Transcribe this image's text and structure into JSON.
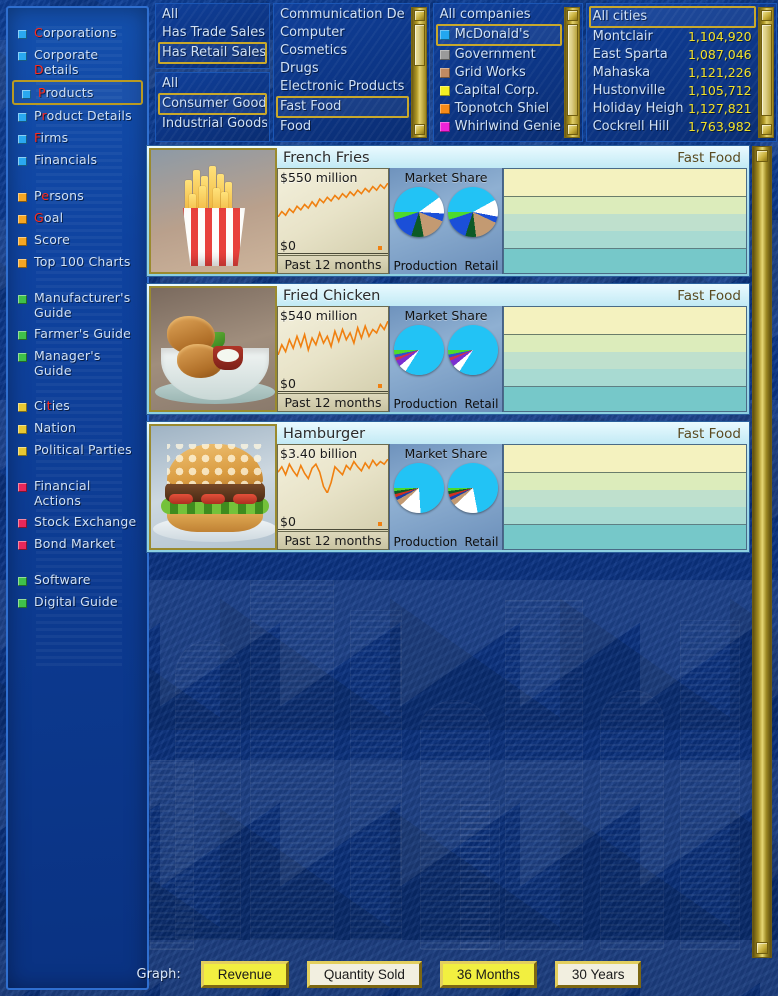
{
  "sidebar": {
    "items": [
      {
        "label": "Corporations",
        "hotkey": "C",
        "bullet": "#2aa8f0",
        "group": 0
      },
      {
        "label": "Corporate Details",
        "hotkey": "D",
        "bullet": "#2aa8f0",
        "group": 0
      },
      {
        "label": "Products",
        "hotkey": "P",
        "bullet": "#2aa8f0",
        "group": 0,
        "selected": true
      },
      {
        "label": "Product Details",
        "hotkey": "r",
        "bullet": "#2aa8f0",
        "group": 0
      },
      {
        "label": "Firms",
        "hotkey": "F",
        "bullet": "#2aa8f0",
        "group": 0
      },
      {
        "label": "Financials",
        "hotkey": "",
        "bullet": "#2aa8f0",
        "group": 0
      },
      {
        "label": "Persons",
        "hotkey": "e",
        "bullet": "#f5a623",
        "group": 1
      },
      {
        "label": "Goal",
        "hotkey": "G",
        "bullet": "#f5a623",
        "group": 1
      },
      {
        "label": "Score",
        "hotkey": "",
        "bullet": "#f5a623",
        "group": 1
      },
      {
        "label": "Top 100 Charts",
        "hotkey": "",
        "bullet": "#f5a623",
        "group": 1
      },
      {
        "label": "Manufacturer's Guide",
        "hotkey": "",
        "bullet": "#3fc14a",
        "group": 2
      },
      {
        "label": "Farmer's Guide",
        "hotkey": "",
        "bullet": "#3fc14a",
        "group": 2
      },
      {
        "label": "Manager's Guide",
        "hotkey": "",
        "bullet": "#3fc14a",
        "group": 2
      },
      {
        "label": "Cities",
        "hotkey": "t",
        "bullet": "#e8c832",
        "group": 3
      },
      {
        "label": "Nation",
        "hotkey": "",
        "bullet": "#e8c832",
        "group": 3
      },
      {
        "label": "Political Parties",
        "hotkey": "",
        "bullet": "#e8c832",
        "group": 3
      },
      {
        "label": "Financial Actions",
        "hotkey": "",
        "bullet": "#e8275a",
        "group": 4
      },
      {
        "label": "Stock Exchange",
        "hotkey": "",
        "bullet": "#e8275a",
        "group": 4
      },
      {
        "label": "Bond Market",
        "hotkey": "",
        "bullet": "#e8275a",
        "group": 4
      },
      {
        "label": "Software",
        "hotkey": "",
        "bullet": "#3fc14a",
        "group": 5
      },
      {
        "label": "Digital Guide",
        "hotkey": "",
        "bullet": "#3fc14a",
        "group": 5
      }
    ]
  },
  "filters": {
    "sales_filter": {
      "options": [
        "All",
        "Has Trade Sales",
        "Has Retail Sales"
      ],
      "selected": "Has Retail Sales"
    },
    "goods_filter": {
      "options": [
        "All",
        "Consumer Goods",
        "Industrial Goods"
      ],
      "selected": "Consumer Goods"
    },
    "category_filter": {
      "options": [
        "Communication De",
        "Computer",
        "Cosmetics",
        "Drugs",
        "Electronic Products",
        "Fast Food",
        "Food"
      ],
      "selected": "Fast Food"
    },
    "company_filter": {
      "header": "All companies",
      "options": [
        {
          "label": "McDonald's",
          "color": "#22a7ef",
          "selected": true
        },
        {
          "label": "Government",
          "color": "#9a9a9a",
          "selected": false
        },
        {
          "label": "Grid Works",
          "color": "#c08a62",
          "selected": false
        },
        {
          "label": "Capital Corp.",
          "color": "#f2ef22",
          "selected": false
        },
        {
          "label": "Topnotch Shiel",
          "color": "#f58a18",
          "selected": false
        },
        {
          "label": "Whirlwind Genie",
          "color": "#ef22d8",
          "selected": false
        }
      ]
    },
    "city_filter": {
      "header": "All cities",
      "header_selected": true,
      "options": [
        {
          "name": "Montclair",
          "population": "1,104,920"
        },
        {
          "name": "East Sparta",
          "population": "1,087,046"
        },
        {
          "name": "Mahaska",
          "population": "1,121,226"
        },
        {
          "name": "Hustonville",
          "population": "1,105,712"
        },
        {
          "name": "Holiday Heigh",
          "population": "1,127,821"
        },
        {
          "name": "Cockrell Hill",
          "population": "1,763,982"
        }
      ]
    }
  },
  "products": [
    {
      "name": "French Fries",
      "category": "Fast Food",
      "image": "french-fries-photo",
      "revenue_label": "$550 million",
      "zero_label": "$0",
      "period_label": "Past 12 months",
      "market_share_title": "Market Share",
      "production_label": "Production",
      "retail_label": "Retail",
      "production_pie": [
        {
          "color": "#22c3f5",
          "pct": 40
        },
        {
          "color": "#ffffff",
          "pct": 11
        },
        {
          "color": "#1b4fd8",
          "pct": 5
        },
        {
          "color": "#c39a72",
          "pct": 16
        },
        {
          "color": "#0c5a26",
          "pct": 8
        },
        {
          "color": "#1b4fd8",
          "pct": 15
        },
        {
          "color": "#4ddb2c",
          "pct": 5
        }
      ],
      "retail_pie": [
        {
          "color": "#22c3f5",
          "pct": 42
        },
        {
          "color": "#ffffff",
          "pct": 11
        },
        {
          "color": "#1b4fd8",
          "pct": 4
        },
        {
          "color": "#c39a72",
          "pct": 16
        },
        {
          "color": "#0c5a26",
          "pct": 7
        },
        {
          "color": "#1b4fd8",
          "pct": 15
        },
        {
          "color": "#4ddb2c",
          "pct": 5
        }
      ],
      "sparkline": [
        38,
        44,
        40,
        47,
        43,
        50,
        46,
        52,
        48,
        55,
        50,
        58,
        54,
        60,
        56,
        62,
        58,
        64,
        60,
        66,
        62,
        68,
        64,
        70,
        66,
        72,
        68,
        74,
        70,
        76
      ]
    },
    {
      "name": "Fried Chicken",
      "category": "Fast Food",
      "image": "fried-chicken-photo",
      "revenue_label": "$540 million",
      "zero_label": "$0",
      "period_label": "Past 12 months",
      "market_share_title": "Market Share",
      "production_label": "Production",
      "retail_label": "Retail",
      "production_pie": [
        {
          "color": "#22c3f5",
          "pct": 84
        },
        {
          "color": "#ffffff",
          "pct": 5
        },
        {
          "color": "#7b2fd0",
          "pct": 4
        },
        {
          "color": "#d02f4f",
          "pct": 2
        },
        {
          "color": "#2f4fd0",
          "pct": 2
        },
        {
          "color": "#4ddb2c",
          "pct": 3
        }
      ],
      "retail_pie": [
        {
          "color": "#22c3f5",
          "pct": 84
        },
        {
          "color": "#ffffff",
          "pct": 5
        },
        {
          "color": "#7b2fd0",
          "pct": 4
        },
        {
          "color": "#d02f4f",
          "pct": 2
        },
        {
          "color": "#2f4fd0",
          "pct": 2
        },
        {
          "color": "#4ddb2c",
          "pct": 3
        }
      ],
      "sparkline": [
        40,
        52,
        44,
        58,
        48,
        62,
        50,
        64,
        46,
        60,
        52,
        66,
        54,
        62,
        50,
        68,
        56,
        70,
        58,
        66,
        54,
        72,
        60,
        74,
        62,
        70,
        66,
        76,
        70,
        80
      ]
    },
    {
      "name": "Hamburger",
      "category": "Fast Food",
      "image": "hamburger-photo",
      "revenue_label": "$3.40 billion",
      "zero_label": "$0",
      "period_label": "Past 12 months",
      "market_share_title": "Market Share",
      "production_label": "Production",
      "retail_label": "Retail",
      "production_pie": [
        {
          "color": "#22c3f5",
          "pct": 74
        },
        {
          "color": "#ffffff",
          "pct": 14
        },
        {
          "color": "#c39a72",
          "pct": 4
        },
        {
          "color": "#1b3fa8",
          "pct": 2
        },
        {
          "color": "#d02f20",
          "pct": 2
        },
        {
          "color": "#0c5a26",
          "pct": 2
        },
        {
          "color": "#4ddb2c",
          "pct": 2
        }
      ],
      "retail_pie": [
        {
          "color": "#22c3f5",
          "pct": 72
        },
        {
          "color": "#ffffff",
          "pct": 16
        },
        {
          "color": "#c39a72",
          "pct": 4
        },
        {
          "color": "#1b3fa8",
          "pct": 2
        },
        {
          "color": "#d02f20",
          "pct": 2
        },
        {
          "color": "#0c5a26",
          "pct": 2
        },
        {
          "color": "#4ddb2c",
          "pct": 2
        }
      ],
      "sparkline": [
        62,
        70,
        58,
        74,
        64,
        56,
        72,
        60,
        52,
        68,
        74,
        62,
        40,
        30,
        46,
        70,
        64,
        58,
        72,
        66,
        78,
        70,
        64,
        76,
        68,
        80,
        72,
        78,
        74,
        82
      ]
    }
  ],
  "toolbar": {
    "graph_label": "Graph:",
    "buttons": [
      {
        "label": "Revenue",
        "active": true
      },
      {
        "label": "Quantity Sold",
        "active": false
      },
      {
        "label": "36 Months",
        "active": true
      },
      {
        "label": "30 Years",
        "active": false
      }
    ]
  }
}
